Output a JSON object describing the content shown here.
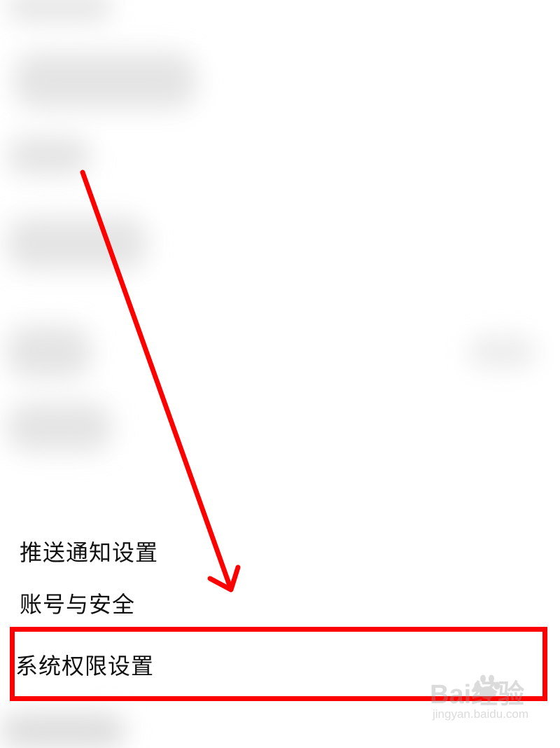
{
  "settings_menu": {
    "items": [
      {
        "label": "推送通知设置"
      },
      {
        "label": "账号与安全"
      },
      {
        "label": "系统权限设置",
        "highlighted": true
      }
    ]
  },
  "annotation": {
    "color": "#ff0000",
    "type": "arrow-pointing-to-highlight"
  },
  "watermark": {
    "brand": "Bai经验",
    "url": "jingyan.baidu.com",
    "icon": "baidu-paw-icon"
  }
}
